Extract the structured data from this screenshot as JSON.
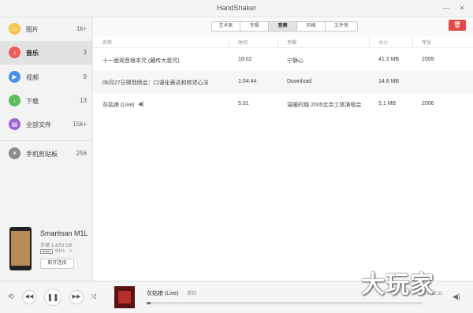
{
  "window": {
    "title": "HandShaker",
    "minimize": "—",
    "close": "✕"
  },
  "sidebar": {
    "items": [
      {
        "label": "图片",
        "count": "1k+",
        "icon": "picture-icon",
        "color": "#f3c54d"
      },
      {
        "label": "音乐",
        "count": "3",
        "icon": "music-icon",
        "color": "#ef5b57"
      },
      {
        "label": "视频",
        "count": "9",
        "icon": "video-icon",
        "color": "#4a8ee8"
      },
      {
        "label": "下载",
        "count": "13",
        "icon": "download-icon",
        "color": "#5bbd5a"
      },
      {
        "label": "全部文件",
        "count": "15k+",
        "icon": "all-files-icon",
        "color": "#9a63d6"
      },
      {
        "label": "手机剪贴板",
        "count": "256",
        "icon": "clipboard-icon",
        "color": "#8a8a8a"
      }
    ],
    "active_index": 1
  },
  "device": {
    "name": "Smartisan M1L",
    "storage": "存储 1.4/53 GB",
    "battery": "94%",
    "battery_level": 0.94,
    "disconnect_label": "断开连接"
  },
  "tabs": {
    "items": [
      "艺术家",
      "专辑",
      "音频",
      "风格",
      "文件夹"
    ],
    "active_index": 2
  },
  "toolbar": {
    "delete_icon": "trash-icon",
    "delete_color": "#e24b48"
  },
  "table": {
    "columns": [
      "名称",
      "时间",
      "专辑",
      "大小",
      "年份"
    ],
    "rows": [
      {
        "name": "十一面观音根本咒 (藏传大悲咒)",
        "time": "18:02",
        "album": "宁静心",
        "size": "41.3 MB",
        "year": "2009"
      },
      {
        "name": "06月27日得到例会：口语化表达和转述心法",
        "time": "1:04:44",
        "album": "Download",
        "size": "14.8 MB",
        "year": ""
      },
      {
        "name": "灰姑娘 (Live)",
        "time": "5:31",
        "album": "温暖的城 2005北京工体演唱会",
        "size": "5.1 MB",
        "year": "2006"
      }
    ]
  },
  "player": {
    "title": "灰姑娘 (Live)",
    "artist": "郑钧",
    "time": "00:05/5:31",
    "progress": 0.015
  },
  "watermark": "大玩家"
}
